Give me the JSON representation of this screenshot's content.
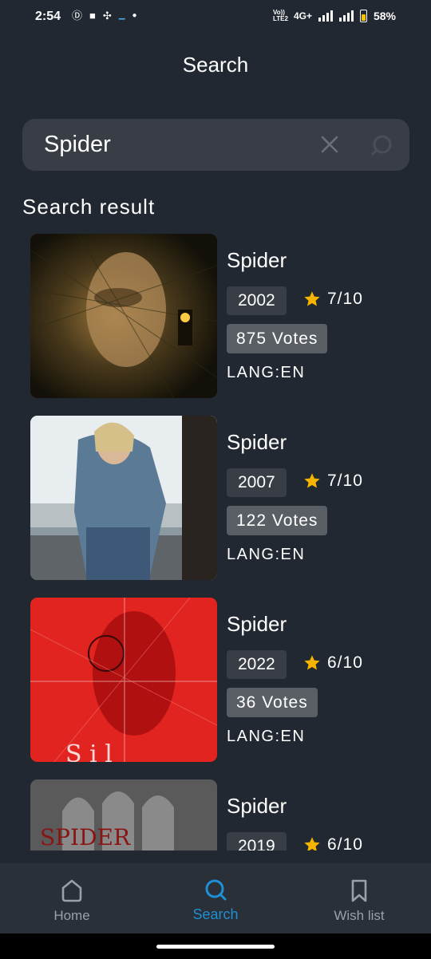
{
  "status_bar": {
    "time": "2:54",
    "network": "4G+",
    "lte_label": "Vo)) LTE2",
    "battery": "58%",
    "battery_level": 0.58
  },
  "header": {
    "title": "Search"
  },
  "search": {
    "value": "Spider"
  },
  "section": {
    "title": "Search result"
  },
  "results": [
    {
      "title": "Spider",
      "year": "2002",
      "rating": "7/10",
      "votes": "875 Votes",
      "lang": "LANG:EN"
    },
    {
      "title": "Spider",
      "year": "2007",
      "rating": "7/10",
      "votes": "122 Votes",
      "lang": "LANG:EN"
    },
    {
      "title": "Spider",
      "year": "2022",
      "rating": "6/10",
      "votes": "36 Votes",
      "lang": "LANG:EN"
    },
    {
      "title": "Spider",
      "year": "2019",
      "rating": "6/10",
      "votes": "",
      "lang": ""
    }
  ],
  "posters": {
    "poster_3_text": "S  i  l",
    "poster_4_text": "SPIDER"
  },
  "nav": {
    "items": [
      {
        "label": "Home",
        "icon": "home-icon",
        "active": false
      },
      {
        "label": "Search",
        "icon": "search-icon",
        "active": true
      },
      {
        "label": "Wish list",
        "icon": "bookmark-icon",
        "active": false
      }
    ]
  },
  "colors": {
    "background": "#222831",
    "card": "#393e46",
    "accent": "#1e90d6",
    "star": "#f5b400"
  }
}
